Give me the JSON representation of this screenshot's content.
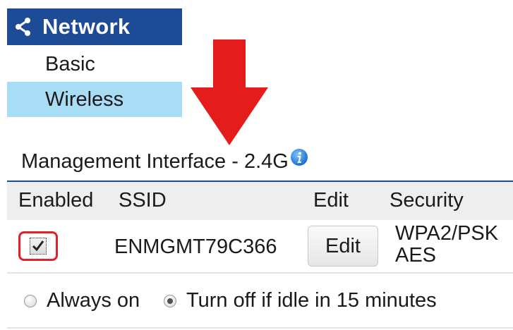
{
  "nav": {
    "header_title": "Network",
    "header_icon": "share-icon",
    "items": [
      {
        "label": "Basic",
        "selected": false
      },
      {
        "label": "Wireless",
        "selected": true
      }
    ],
    "header_color": "#1e4b96",
    "selected_color": "#a9dcf5"
  },
  "annotation": {
    "arrow_color": "#e41c1c"
  },
  "management": {
    "title": "Management Interface - 2.4G",
    "info_icon": "info-icon",
    "columns": [
      "Enabled",
      "SSID",
      "Edit",
      "Security"
    ],
    "row": {
      "enabled": true,
      "ssid": "ENMGMT79C366",
      "edit_label": "Edit",
      "security_line1": "WPA2/PSK",
      "security_line2": "AES"
    }
  },
  "power": {
    "options": [
      {
        "label": "Always on",
        "selected": false
      },
      {
        "label": "Turn off if idle in 15 minutes",
        "selected": true
      }
    ]
  }
}
